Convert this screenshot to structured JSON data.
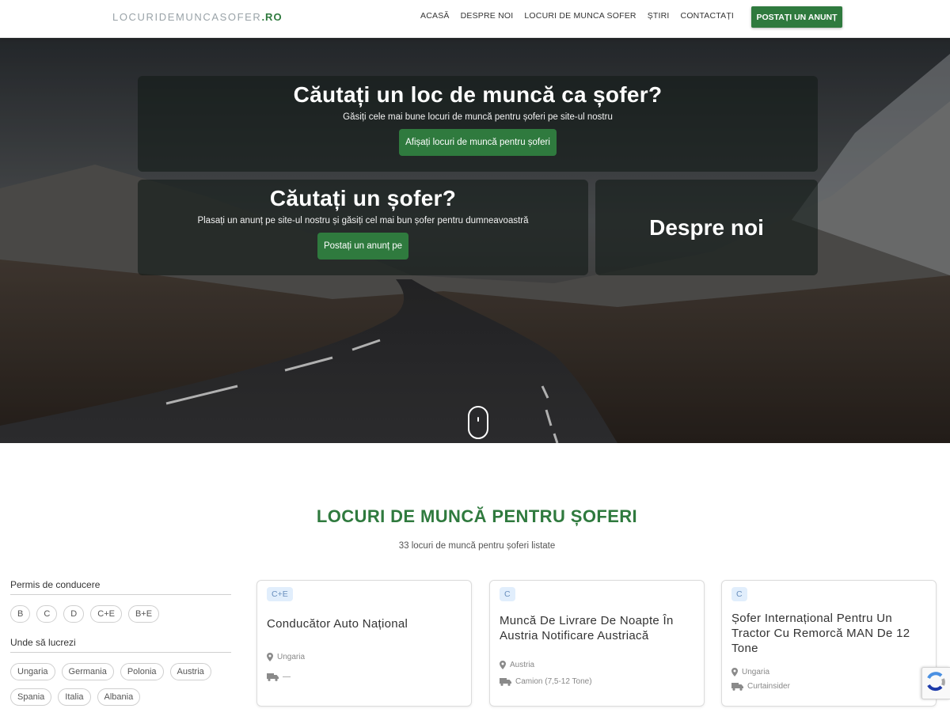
{
  "header": {
    "logo_main": "LOCURIDEMUNCASOFER",
    "logo_tld": ".RO",
    "nav": [
      "ACASĂ",
      "DESPRE NOI",
      "LOCURI DE MUNCA SOFER",
      "ȘTIRI",
      "CONTACTAȚI"
    ],
    "cta": "POSTAȚI UN ANUNȚ"
  },
  "hero": {
    "panel_top": {
      "title": "Căutați un loc de muncă ca șofer?",
      "subtitle": "Găsiți cele mai bune locuri de muncă pentru șoferi pe site-ul nostru",
      "button": "Afișați locuri de muncă pentru șoferi"
    },
    "panel_left": {
      "title": "Căutați un șofer?",
      "subtitle": "Plasați un anunț pe site-ul nostru și găsiți cel mai bun șofer pentru dumneavoastră",
      "button": "Postați un anunț pe"
    },
    "panel_right": {
      "title": "Despre noi"
    }
  },
  "section": {
    "title": "LOCURI DE MUNCĂ PENTRU ȘOFERI",
    "subtitle": "33 locuri de muncă pentru șoferi listate"
  },
  "filters": {
    "license_title": "Permis de conducere",
    "licenses": [
      "B",
      "C",
      "D",
      "C+E",
      "B+E"
    ],
    "where_title": "Unde să lucrezi",
    "countries": [
      "Ungaria",
      "Germania",
      "Polonia",
      "Austria",
      "Spania",
      "Italia",
      "Albania"
    ]
  },
  "jobs": [
    {
      "badge": "C+E",
      "title_lines": [
        "Conducător Auto Național"
      ],
      "location": "Ungaria",
      "vehicle": "—"
    },
    {
      "badge": "C",
      "title_lines": [
        "Muncă De Livrare De Noapte În",
        "Austria Notificare Austriacă"
      ],
      "location": "Austria",
      "vehicle": "Camion (7,5-12 Tone)"
    },
    {
      "badge": "C",
      "title_lines": [
        "Șofer Internațional Pentru Un",
        "Tractor Cu Remorcă MAN De 12",
        "Tone"
      ],
      "location": "Ungaria",
      "vehicle": "Curtainsider"
    }
  ],
  "colors": {
    "brand_green": "#2f7a3e",
    "badge_bg": "#e1eefc"
  },
  "icons": {
    "location": "map-pin-icon",
    "vehicle": "truck-icon",
    "scroll": "scroll-mouse-icon",
    "captcha": "recaptcha-icon"
  }
}
